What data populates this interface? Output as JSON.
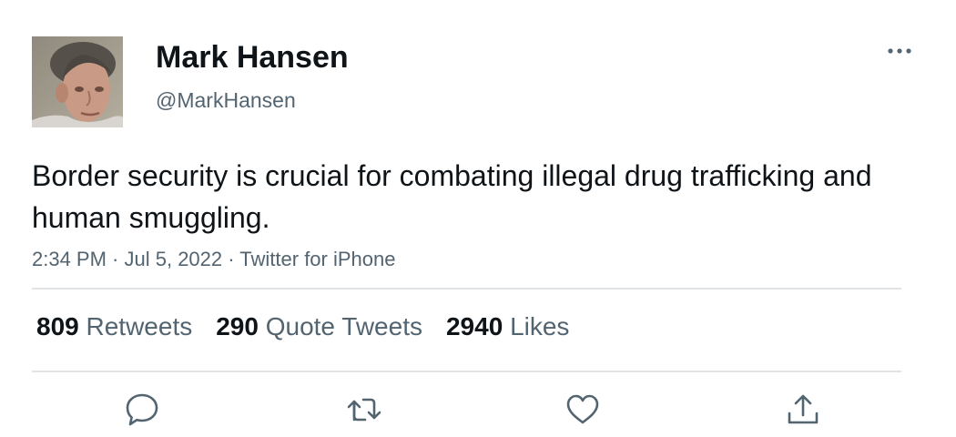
{
  "author": {
    "display_name": "Mark Hansen",
    "handle": "@MarkHansen"
  },
  "tweet": {
    "text": "Border security is crucial for combating illegal drug trafficking and human smuggling.",
    "time": "2:34 PM",
    "date": "Jul 5, 2022",
    "source": "Twitter for iPhone",
    "separator": " · "
  },
  "stats": {
    "retweets_count": "809",
    "retweets_label": "Retweets",
    "quotes_count": "290",
    "quotes_label": "Quote Tweets",
    "likes_count": "2940",
    "likes_label": "Likes"
  },
  "icons": {
    "more": "more-dots-icon",
    "reply": "reply-icon",
    "retweet": "retweet-icon",
    "like": "heart-icon",
    "share": "share-icon"
  },
  "colors": {
    "text_primary": "#0f1419",
    "text_secondary": "#536471",
    "divider": "#e1e4e6",
    "icon": "#536471"
  }
}
